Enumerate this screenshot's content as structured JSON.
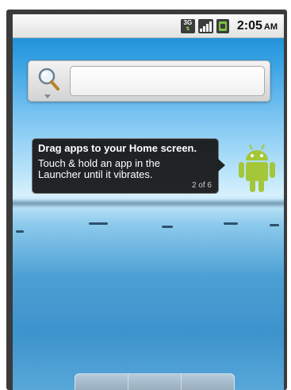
{
  "status_bar": {
    "network_label": "3G",
    "time": "2:05",
    "ampm": "AM"
  },
  "tooltip": {
    "title": "Drag apps to your Home screen.",
    "body": "Touch & hold an app in the Launcher until it vibrates.",
    "page": "2 of 6"
  },
  "icons": {
    "search": "search-icon",
    "android": "android-icon",
    "battery": "battery-icon",
    "signal": "signal-icon",
    "network": "3g-icon"
  },
  "colors": {
    "android_green": "#a4c639",
    "tooltip_bg": "#141414"
  }
}
